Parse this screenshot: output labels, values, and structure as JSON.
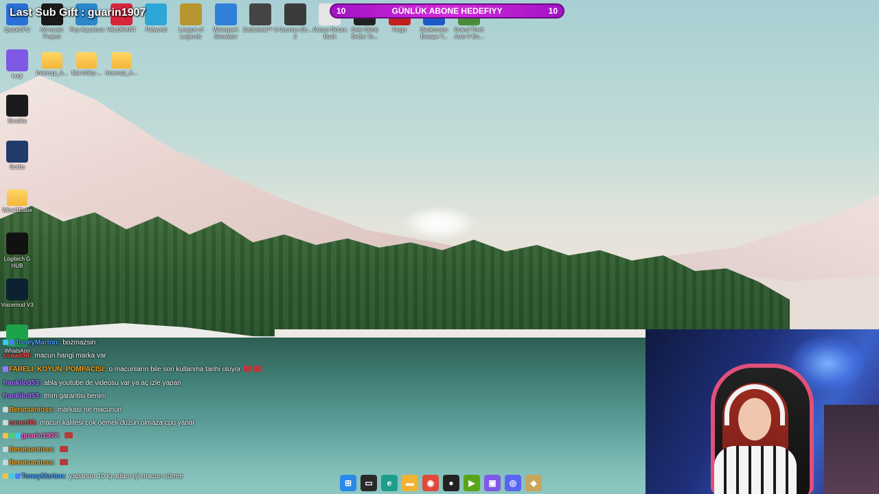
{
  "overlay": {
    "last_sub_gift": "Last Sub Gift : guarin1907",
    "goal_title": "GÜNLÜK ABONE HEDEFIYY",
    "goal_current": "10",
    "goal_target": "10"
  },
  "desktop_icons_top": [
    {
      "label": "QuickCPU"
    },
    {
      "label": "lofi music Project"
    },
    {
      "label": "Tiny Aquarium"
    },
    {
      "label": "VALORANT"
    },
    {
      "label": "Palworld"
    },
    {
      "label": "League of Legends"
    },
    {
      "label": "Waterpark Simulator"
    },
    {
      "label": "Battlefield™ 6"
    },
    {
      "label": "Counter-Str... 2"
    },
    {
      "label": "Goose Goose Duck"
    },
    {
      "label": "Only Climb Better To..."
    },
    {
      "label": "Feign"
    },
    {
      "label": "Backrooms Escape T..."
    },
    {
      "label": "Grand Theft Auto V En..."
    }
  ],
  "desktop_icons_row2": [
    {
      "label": "Logi"
    },
    {
      "label": "Interrupt_A..."
    },
    {
      "label": "Msi-Utility-..."
    },
    {
      "label": "Interrupt_A..."
    }
  ],
  "desktop_icons_left": [
    {
      "label": "Sinaliks"
    },
    {
      "label": "Scribs"
    },
    {
      "label": "Winal1Dabe"
    },
    {
      "label": "Logitech G HUB"
    },
    {
      "label": "Voicemod V3"
    },
    {
      "label": "WhatsApp"
    }
  ],
  "chat": [
    {
      "user": "ToneyMarton:",
      "color": "#4ea0ff",
      "text": "bozmazsin",
      "badges": [
        "#3ec7f0",
        "#4d7cff"
      ],
      "emotes": 0
    },
    {
      "user": "ssaaa96:",
      "color": "#ff4f4f",
      "text": "macun hangi marka var",
      "badges": [],
      "emotes": 0
    },
    {
      "user": "FARELI_KOYUN_POMPACISI:",
      "color": "#f5a623",
      "text": "o macunların bile son kullanma tarihi oluyor",
      "badges": [
        "#9b7bff"
      ],
      "emotes": 2,
      "wrap": true
    },
    {
      "user": "frankilo353:",
      "color": "#a675ff",
      "text": "abla youtube de videosu var ya aç izle yapan",
      "badges": [],
      "emotes": 0
    },
    {
      "user": "frankilo353:",
      "color": "#a675ff",
      "text": "tmm garantisi benim",
      "badges": [],
      "emotes": 0
    },
    {
      "user": "Beratsantoss:",
      "color": "#f5a623",
      "text": "markası ne macunun",
      "badges": [
        "#cfd6dd"
      ],
      "emotes": 0
    },
    {
      "user": "caner06:",
      "color": "#ff4f4f",
      "text": "macun kalitesi cok öemeli düzün olmaza cpu yanar",
      "badges": [
        "#cfd6dd"
      ],
      "emotes": 0
    },
    {
      "user": "guarin1907:",
      "color": "#ff6fd0",
      "text": "",
      "badges": [
        "#f5c242",
        "#46d17a",
        "#3ec7f0"
      ],
      "emotes": 1
    },
    {
      "user": "Beratsantoss:",
      "color": "#f5a623",
      "text": "",
      "badges": [
        "#cfd6dd"
      ],
      "emotes": 1
    },
    {
      "user": "Beratsantoss:",
      "color": "#f5a623",
      "text": "",
      "badges": [
        "#cfd6dd"
      ],
      "emotes": 1
    },
    {
      "user": "ToneyMarton:",
      "color": "#4ea0ff",
      "text": "yaparsın 10 iq adam işi macun sürme",
      "badges": [
        "#f5c242",
        "#3ec7f0",
        "#4d7cff"
      ],
      "emotes": 0
    }
  ],
  "taskbar": [
    {
      "icon": "windows-start-icon",
      "color": "#2b8ae8"
    },
    {
      "icon": "task-view-icon",
      "color": "#2a2a2a"
    },
    {
      "icon": "edge-icon",
      "color": "#1e9e8a"
    },
    {
      "icon": "file-explorer-icon",
      "color": "#f2b233"
    },
    {
      "icon": "chrome-icon",
      "color": "#e04a3b"
    },
    {
      "icon": "obs-icon",
      "color": "#222222"
    },
    {
      "icon": "nvidia-icon",
      "color": "#5aa417"
    },
    {
      "icon": "logi-icon",
      "color": "#7f59e6"
    },
    {
      "icon": "discord-icon",
      "color": "#5865f2"
    },
    {
      "icon": "league-icon",
      "color": "#c9a55a"
    }
  ]
}
